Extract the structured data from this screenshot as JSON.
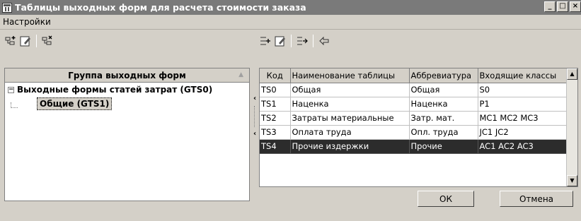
{
  "window": {
    "title": "Таблицы выходных форм для расчета стоимости заказа"
  },
  "menu": {
    "settings": "Настройки"
  },
  "left_panel": {
    "header": "Группа выходных форм",
    "root_label": "Выходные формы статей затрат (GTS0)",
    "child_label": "Общие (GTS1)"
  },
  "grid": {
    "columns": [
      "Код",
      "Наименование таблицы",
      "Аббревиатура",
      "Входящие классы"
    ],
    "rows": [
      [
        "TS0",
        "Общая",
        "Общая",
        "S0"
      ],
      [
        "TS1",
        "Наценка",
        "Наценка",
        "P1"
      ],
      [
        "TS2",
        "Затраты материальные",
        "Затр. мат.",
        "MC1 MC2 MC3"
      ],
      [
        "TS3",
        "Оплата труда",
        "Опл. труда",
        "JC1 JC2"
      ],
      [
        "TS4",
        "Прочие издержки",
        "Прочие",
        "AC1 AC2 AC3"
      ]
    ],
    "selected_row": 4
  },
  "buttons": {
    "ok": "ОК",
    "cancel": "Отмена"
  }
}
